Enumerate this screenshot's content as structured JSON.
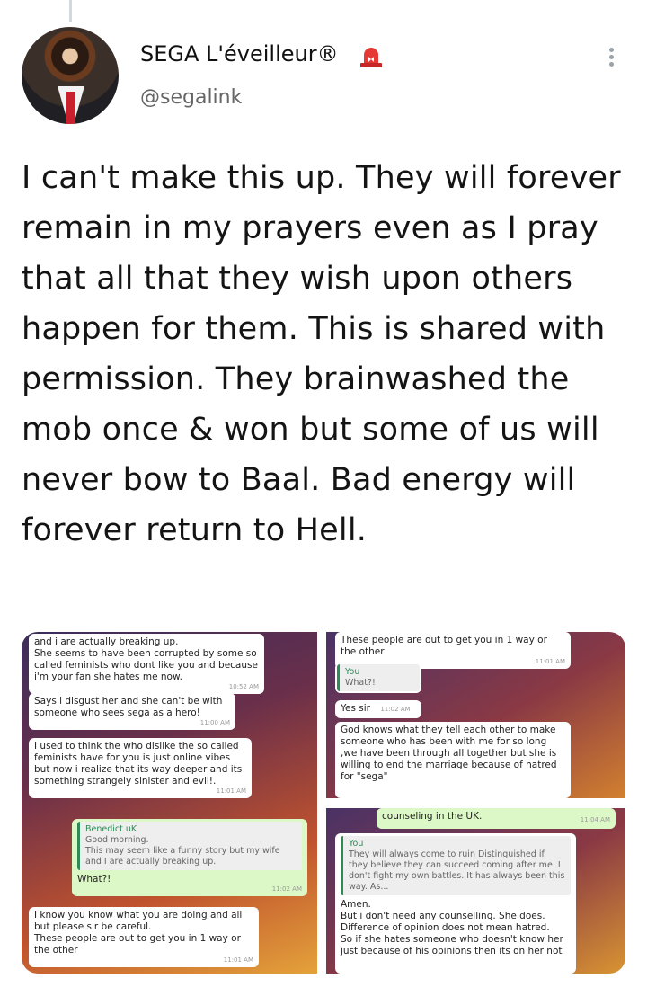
{
  "author": {
    "display_name": "SEGA L'éveilleur®",
    "handle": "@segalink"
  },
  "icons": {
    "alert": "police-light-emoji",
    "more": "more-vertical-icon"
  },
  "colors": {
    "text": "#141414",
    "secondary": "#666666",
    "thread_line": "#cfd9de",
    "whatsapp_out": "#dcf8c6",
    "whatsapp_quote_accent": "#2e8b57"
  },
  "tweet": {
    "text": "I can't make this up. They will forever remain in my prayers even as I pray that all that they wish upon others happen for them. This is shared with permission. They brainwashed the mob once & won but some of us will never bow to Baal. Bad energy will forever return to Hell."
  },
  "media": {
    "left": {
      "m1": {
        "text": "and i are actually breaking up.\nShe seems to have been corrupted by some so called feminists who dont like you and because i'm your fan she hates me now.",
        "time": "10:52 AM"
      },
      "m2": {
        "text": "Says i disgust her and she can't be with someone who sees sega as a hero!",
        "time": "11:00 AM"
      },
      "m3": {
        "text": "I used to think the who dislike the so called feminists have for you is just online vibes but now i realize that its way deeper and its something strangely sinister and evil!.",
        "time": "11:01 AM"
      },
      "m4": {
        "quote_author": "Benedict uK",
        "quote_text": "Good morning.\nThis may seem like a funny story but my wife and I are actually breaking up.",
        "text": "What?!",
        "time": "11:02 AM"
      },
      "m5": {
        "text": "I know you know what you are doing and all but please sir be careful.\nThese people are out to get you in 1 way or the other",
        "time": "11:01 AM"
      }
    },
    "top_right": {
      "m1": {
        "text": "These people are out to get you in 1 way or the other",
        "time": "11:01 AM"
      },
      "m2": {
        "quote_author": "You",
        "quote_text": "What?!"
      },
      "m3": {
        "text": "Yes sir",
        "time": "11:02 AM"
      },
      "m4": {
        "text": "God knows what they tell each other to make someone who has been with me for so long ,we have been through all together but she is willing to end the marriage because of hatred for \"sega\""
      }
    },
    "bottom_right": {
      "m1": {
        "text": "counseling in the UK.",
        "time": "11:04 AM"
      },
      "m2": {
        "quote_author": "You",
        "quote_text": "They will always come to ruin Distinguished if they believe they can succeed coming after me. I don't fight my own battles. It has always been this way. As...",
        "text": "Amen.\nBut i don't need any counselling. She does. Difference of opinion does not mean hatred.\nSo if she hates someone who doesn't know her just because of his opinions then its on her not"
      }
    }
  }
}
